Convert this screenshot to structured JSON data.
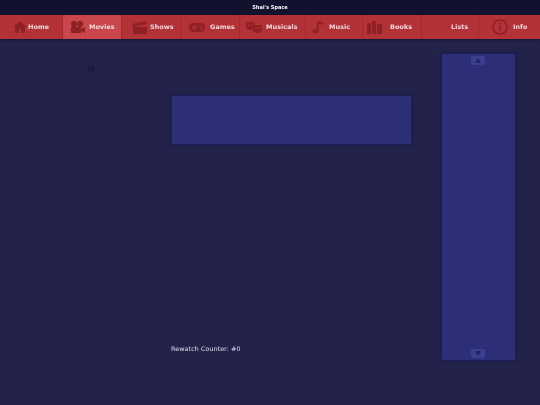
{
  "window": {
    "title": "Shai's Space"
  },
  "nav": {
    "items": [
      {
        "label": "Home",
        "icon": "home-icon"
      },
      {
        "label": "Movies",
        "icon": "movie-camera-icon",
        "active": true
      },
      {
        "label": "Shows",
        "icon": "clapperboard-icon"
      },
      {
        "label": "Games",
        "icon": "gamepad-icon"
      },
      {
        "label": "Musicals",
        "icon": "theater-masks-icon"
      },
      {
        "label": "Music",
        "icon": "music-note-icon"
      },
      {
        "label": "Books",
        "icon": "books-icon"
      },
      {
        "label": "Lists",
        "icon": ""
      },
      {
        "label": "Info",
        "icon": "info-icon"
      }
    ]
  },
  "main": {
    "rewatch_label": "Rewatch Counter:",
    "rewatch_value": "#0"
  },
  "colors": {
    "background": "#22224a",
    "nav_bar": "#b33238",
    "nav_active": "#c9474c",
    "panel": "#2c2f78",
    "title_bar": "#12122e"
  }
}
